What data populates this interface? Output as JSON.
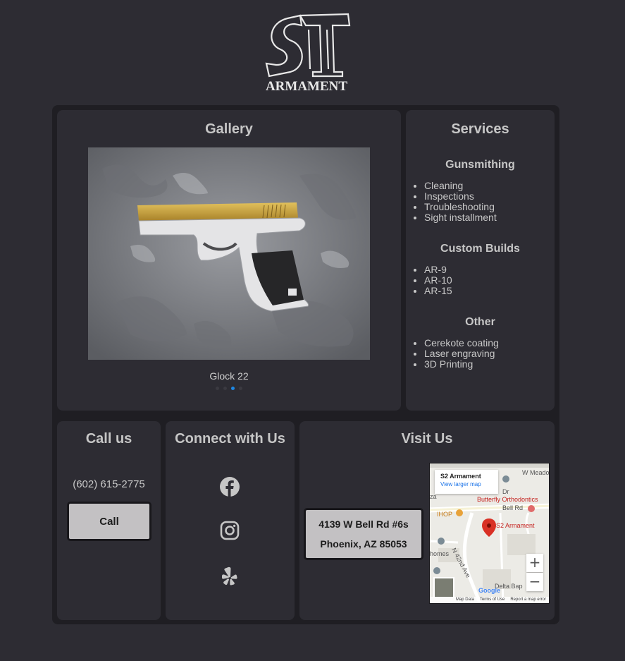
{
  "logo": {
    "monogram": "ST",
    "wordmark": "ARMAMENT"
  },
  "gallery": {
    "title": "Gallery",
    "caption": "Glock 22",
    "slide_count": 4,
    "active_slide": 2
  },
  "services": {
    "title": "Services",
    "groups": [
      {
        "heading": "Gunsmithing",
        "items": [
          "Cleaning",
          "Inspections",
          "Troubleshooting",
          "Sight installment"
        ]
      },
      {
        "heading": "Custom Builds",
        "items": [
          "AR-9",
          "AR-10",
          "AR-15"
        ]
      },
      {
        "heading": "Other",
        "items": [
          "Cerekote coating",
          "Laser engraving",
          "3D Printing"
        ]
      }
    ]
  },
  "call": {
    "title": "Call us",
    "phone": "(602) 615-2775",
    "button_label": "Call"
  },
  "connect": {
    "title": "Connect with Us",
    "icons": [
      "facebook-icon",
      "instagram-icon",
      "yelp-icon"
    ]
  },
  "visit": {
    "title": "Visit Us",
    "address_line1": "4139 W Bell Rd #6s",
    "address_line2": "Phoenix, AZ 85053",
    "map": {
      "place_name": "S2 Armament",
      "link": "View larger map",
      "pin_label": "S2 Armament",
      "labels": [
        "W Meado",
        "Dr",
        "Butterfly Orthodontics",
        "Bell Rd",
        "IHOP",
        "N 42nd Ave",
        "homes",
        "Delta Bap",
        "za"
      ],
      "zoom_in": "+",
      "zoom_out": "−",
      "footer": [
        "Map Data",
        "Terms of Use",
        "Report a map error"
      ],
      "brand": "Google"
    }
  },
  "colors": {
    "background": "#2d2c33",
    "frame": "#1f1e23",
    "button": "#c3c1c3",
    "accent_dot": "#1e88e5",
    "slide_gold": "#c9a335"
  }
}
